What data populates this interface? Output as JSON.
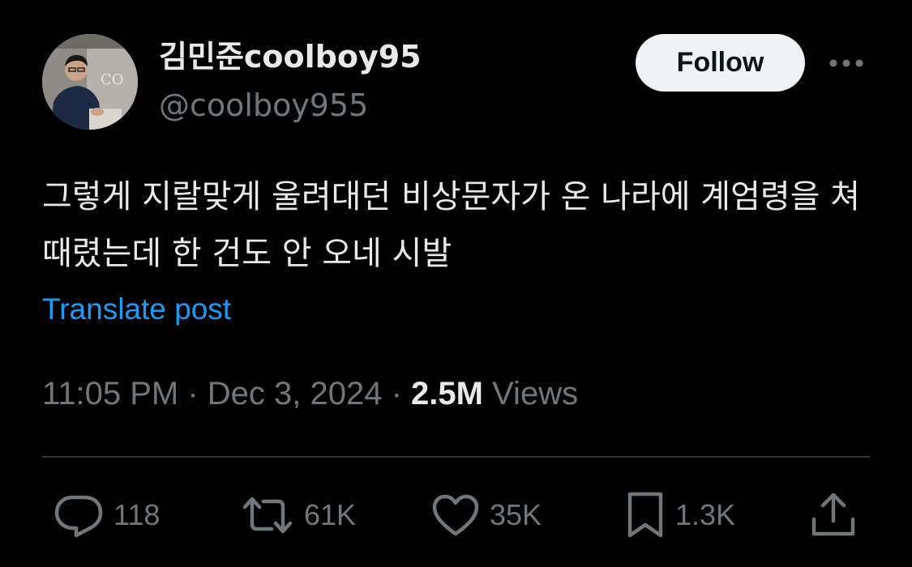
{
  "user": {
    "display_name": "김민준coolboy95",
    "handle": "@coolboy955",
    "avatar_icon": "profile-photo-icon"
  },
  "header": {
    "follow_label": "Follow",
    "more_icon": "more-horizontal-icon"
  },
  "tweet": {
    "text": "그렇게 지랄맞게 울려대던 비상문자가 온 나라에 계엄령을 쳐 때렸는데 한 건도 안 오네 시발",
    "translate_label": "Translate post",
    "time": "11:05 PM",
    "separator": " · ",
    "date": "Dec 3, 2024",
    "views_count": "2.5M",
    "views_label": " Views"
  },
  "actions": {
    "replies": {
      "icon": "reply-icon",
      "count": "118"
    },
    "reposts": {
      "icon": "repost-icon",
      "count": "61K"
    },
    "likes": {
      "icon": "heart-icon",
      "count": "35K"
    },
    "bookmarks": {
      "icon": "bookmark-icon",
      "count": "1.3K"
    },
    "share": {
      "icon": "share-icon"
    }
  },
  "colors": {
    "background": "#000000",
    "primary_text": "#e7e9ea",
    "secondary_text": "#71767b",
    "link": "#1d9bf0",
    "divider": "#2f3336",
    "follow_bg": "#eff3f4"
  }
}
